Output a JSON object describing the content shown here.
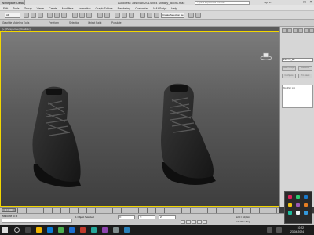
{
  "window": {
    "workspace_label": "Workspace: Default",
    "title": "Autodesk 3ds Max 2014 x64   Military_Boots.max",
    "search_placeholder": "Type a keyword or phrase",
    "sign_in": "Sign In"
  },
  "menu": [
    "Edit",
    "Tools",
    "Group",
    "Views",
    "Create",
    "Modifiers",
    "Animation",
    "Graph Editors",
    "Rendering",
    "Customize",
    "MAXScript",
    "Help"
  ],
  "toolbar": {
    "selection_filter": "All",
    "view_dropdown": "Create Selection Se"
  },
  "ribbon": {
    "tabs": [
      "Graphite Modeling Tools",
      "Freeform",
      "Selection",
      "Object Paint",
      "Populate"
    ]
  },
  "viewport": {
    "label": "[+] [Perspective] [Realistic]",
    "selected_object": "Boot"
  },
  "command_panel": {
    "object_name": "Military_Bo",
    "buttons": [
      "Make Unique",
      "Remove",
      "Configure",
      "Pin Stack"
    ],
    "list_label": "Modifier List"
  },
  "timeline": {
    "frame": "0 / 100"
  },
  "status": {
    "label": "Welcome to M",
    "selection": "1 Object Selected",
    "x": "X:",
    "y": "Y:",
    "z": "Z:",
    "grid": "Grid = 10,0cm",
    "add_time_tag": "Add Time Tag"
  },
  "taskbar": {
    "time": "10:22",
    "date": "23.04.2024"
  },
  "colors": {
    "viewport_border": "#f2d600",
    "accent": "#1979ca"
  }
}
